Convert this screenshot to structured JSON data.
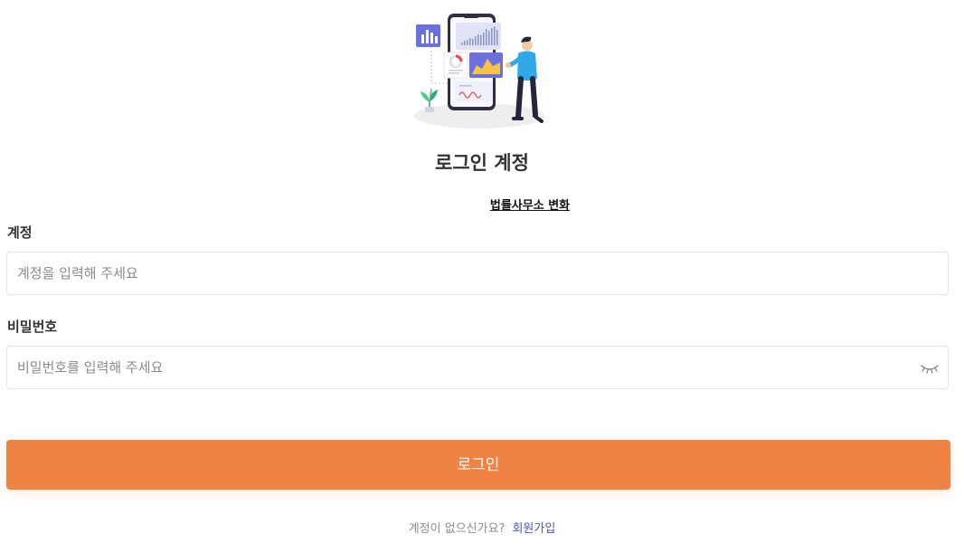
{
  "login": {
    "title": "로그인 계정",
    "office_switch": "법률사무소 변화",
    "account": {
      "label": "계정",
      "placeholder": "계정을 입력해 주세요",
      "value": ""
    },
    "password": {
      "label": "비밀번호",
      "placeholder": "비밀번호를 입력해 주세요",
      "value": "",
      "toggle_icon": "eye-closed-icon"
    },
    "submit_label": "로그인",
    "signup_prompt": "계정이 없으신가요?",
    "signup_link": "회원가입"
  },
  "illustration": {
    "icon": "analytics-illustration"
  },
  "colors": {
    "primary": "#ef8343",
    "link": "#4a55c8",
    "text": "#333333",
    "placeholder": "#8a8a8a",
    "border": "#e3e3e3"
  }
}
